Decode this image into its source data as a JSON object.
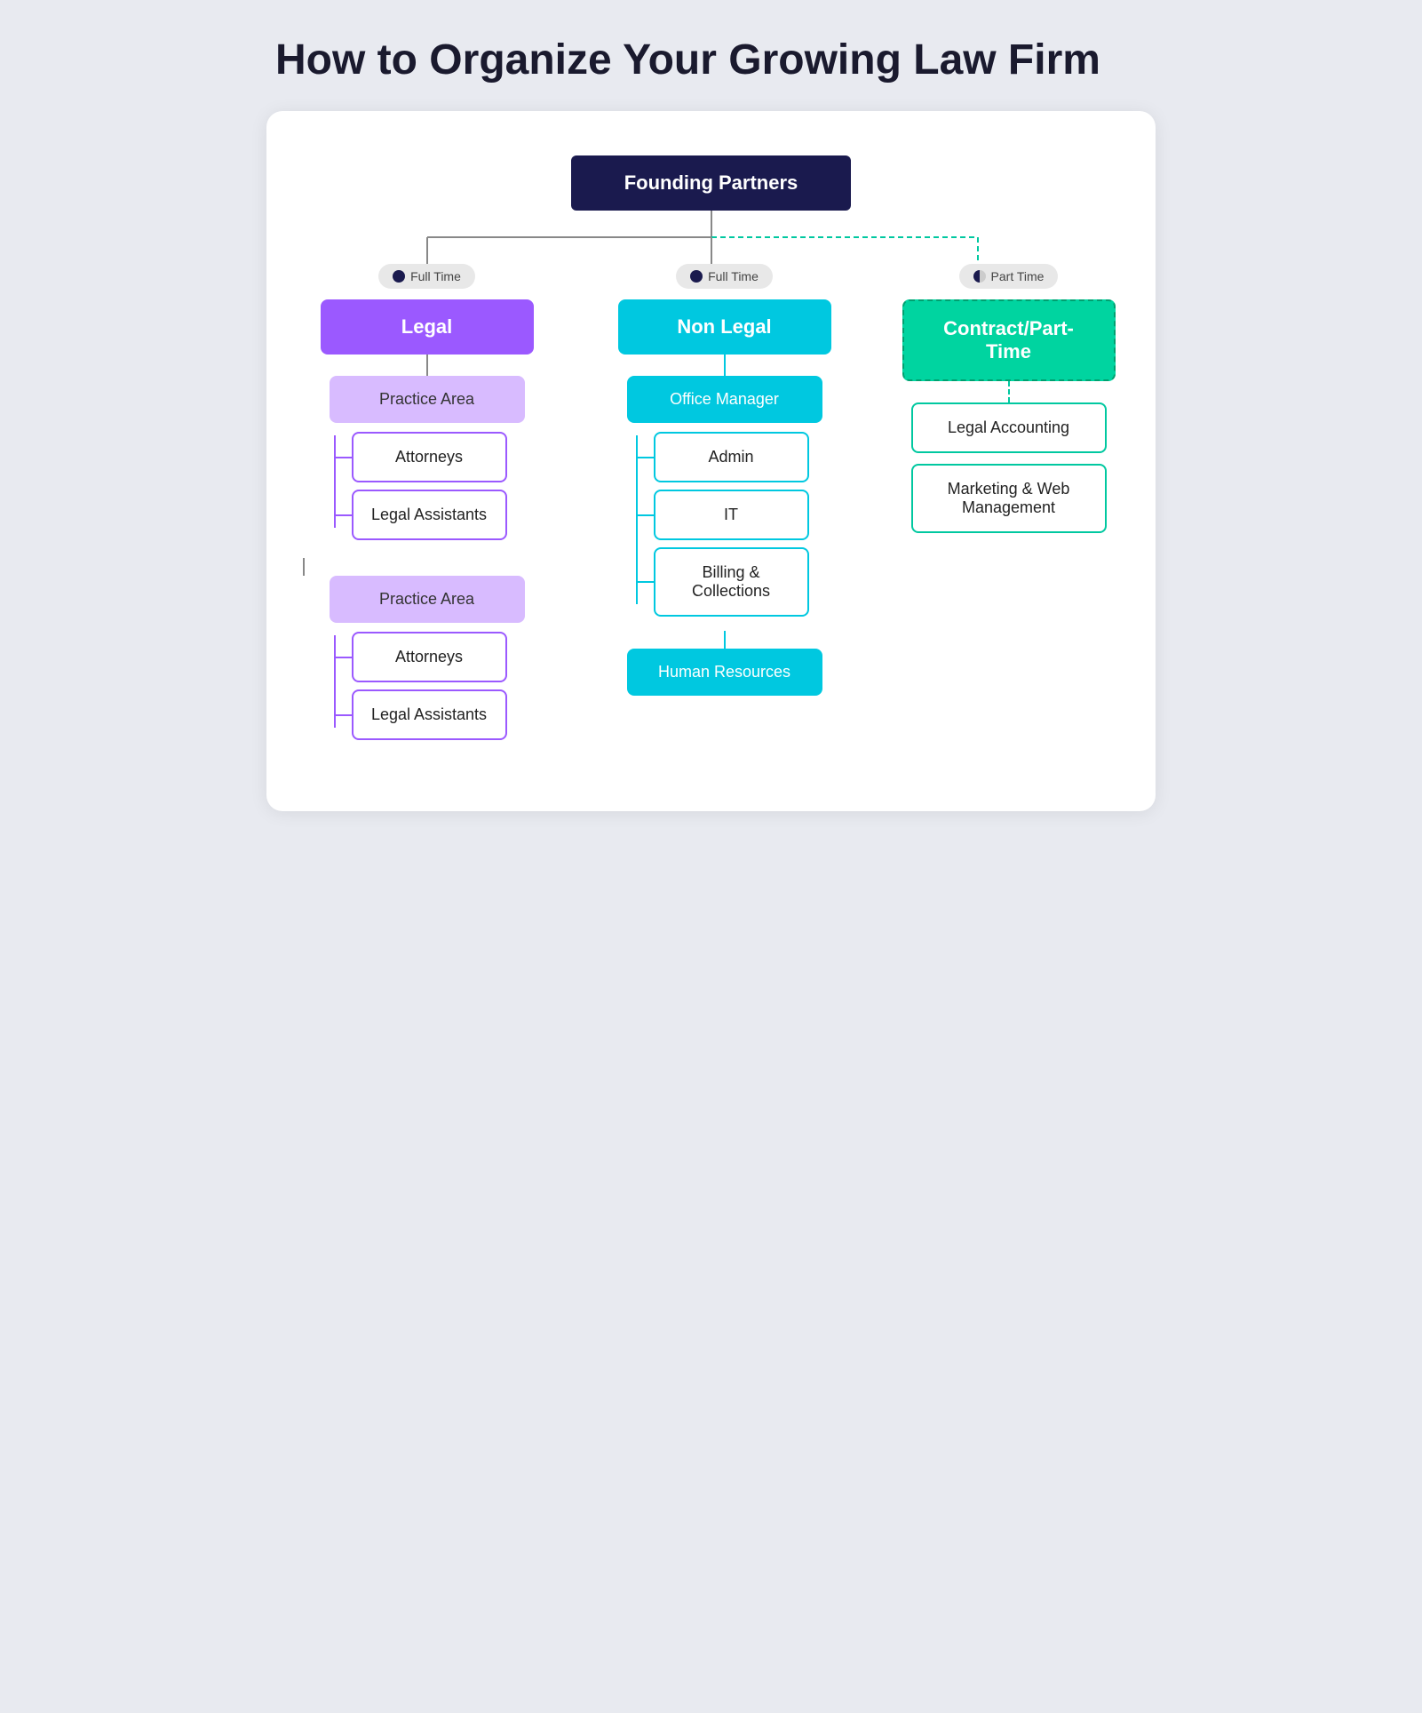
{
  "title": "How to Organize Your Growing Law Firm",
  "founding_box": "Founding Partners",
  "badges": {
    "full_time_1": "Full Time",
    "full_time_2": "Full Time",
    "part_time": "Part Time"
  },
  "columns": {
    "legal": {
      "label": "Legal",
      "practice_areas": [
        {
          "label": "Practice Area",
          "children": [
            "Attorneys",
            "Legal Assistants"
          ]
        },
        {
          "label": "Practice Area",
          "children": [
            "Attorneys",
            "Legal Assistants"
          ]
        }
      ]
    },
    "nonlegal": {
      "label": "Non Legal",
      "office_manager": "Office Manager",
      "office_children": [
        "Admin",
        "IT",
        "Billing & Collections"
      ],
      "human_resources": "Human Resources"
    },
    "contract": {
      "label": "Contract/Part-Time",
      "children": [
        "Legal Accounting",
        "Marketing & Web Management"
      ]
    }
  },
  "colors": {
    "founding": "#1a1a4e",
    "legal_header": "#9b59ff",
    "legal_practice": "#d8bbff",
    "legal_child_border": "#9b59ff",
    "nonlegal_header": "#00c8e0",
    "nonlegal_child_border": "#00c8e0",
    "contract_header": "#00d4a0",
    "contract_border": "#00c8a0",
    "badge_bg": "#e0e0e0",
    "badge_text": "#444444",
    "title_color": "#1a1a2e"
  }
}
